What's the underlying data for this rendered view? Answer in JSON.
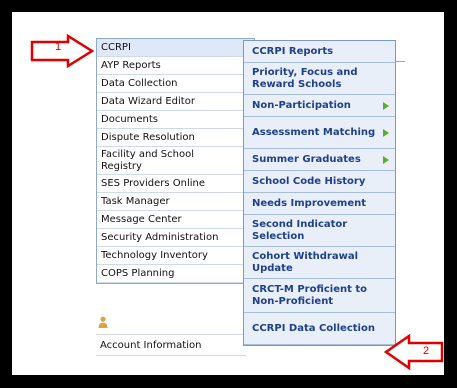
{
  "left_menu": {
    "items": [
      {
        "label": "CCRPI",
        "arrow": "green",
        "active": true
      },
      {
        "label": "AYP Reports",
        "arrow": "none"
      },
      {
        "label": "Data Collection",
        "arrow": "green"
      },
      {
        "label": "Data Wizard Editor",
        "arrow": "none"
      },
      {
        "label": "Documents",
        "arrow": "gray"
      },
      {
        "label": "Dispute Resolution",
        "arrow": "none"
      },
      {
        "label": "Facility and School Registry",
        "arrow": "green"
      },
      {
        "label": "SES Providers Online",
        "arrow": "green"
      },
      {
        "label": "Task Manager",
        "arrow": "gray"
      },
      {
        "label": "Message Center",
        "arrow": "none"
      },
      {
        "label": "Security Administration",
        "arrow": "green"
      },
      {
        "label": "Technology Inventory",
        "arrow": "green"
      },
      {
        "label": "COPS Planning",
        "arrow": "green"
      }
    ]
  },
  "submenu": {
    "items": [
      {
        "label": "CCRPI Reports",
        "arrow": "none"
      },
      {
        "label": "Priority, Focus and Reward Schools",
        "arrow": "none"
      },
      {
        "label": "Non-Participation",
        "arrow": "green"
      },
      {
        "label": "Assessment Matching",
        "arrow": "green"
      },
      {
        "label": "Summer Graduates",
        "arrow": "green"
      },
      {
        "label": "School Code History",
        "arrow": "none"
      },
      {
        "label": "Needs Improvement",
        "arrow": "none"
      },
      {
        "label": "Second Indicator Selection",
        "arrow": "none"
      },
      {
        "label": "Cohort Withdrawal Update",
        "arrow": "none"
      },
      {
        "label": "CRCT-M Proficient to Non-Proficient",
        "arrow": "none"
      },
      {
        "label": "CCRPI Data Collection",
        "arrow": "none"
      }
    ]
  },
  "account": {
    "label": "Account Information"
  },
  "callouts": {
    "first": "1",
    "second": "2"
  },
  "colors": {
    "arrow_green": "#63a82e",
    "callout_red": "#e00000",
    "submenu_text": "#1f3f8f"
  }
}
